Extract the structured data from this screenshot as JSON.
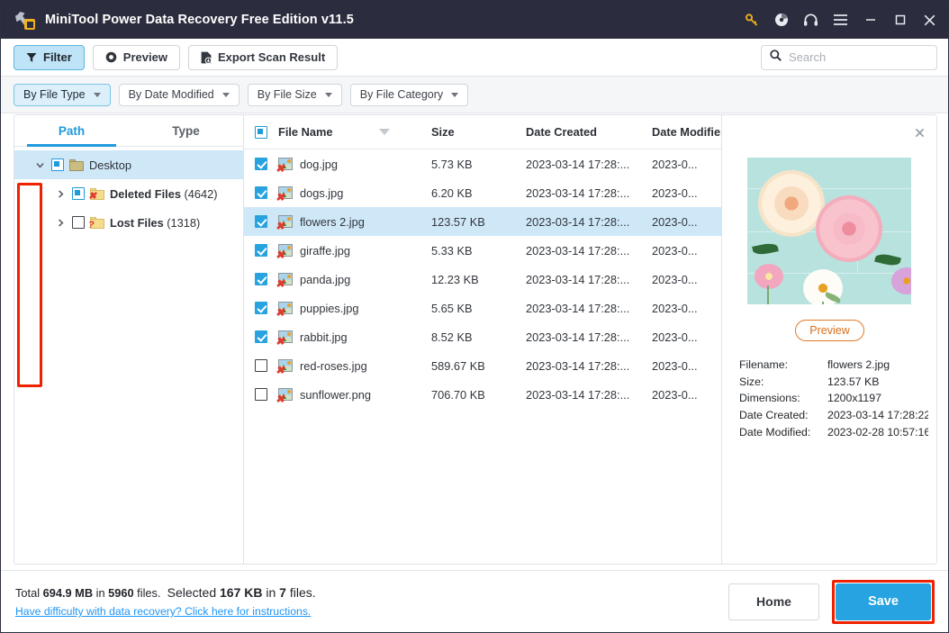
{
  "window": {
    "title": "MiniTool Power Data Recovery Free Edition v11.5",
    "icons": {
      "key": "key-icon",
      "disc": "disc-icon",
      "headphones": "headphones-icon",
      "menu": "hamburger-menu-icon",
      "minimize": "minimize-icon",
      "maximize": "maximize-icon",
      "close": "close-icon"
    }
  },
  "toolbar": {
    "filter_label": "Filter",
    "preview_label": "Preview",
    "export_label": "Export Scan Result"
  },
  "search": {
    "placeholder": "Search",
    "value": ""
  },
  "filters": [
    {
      "label": "By File Type",
      "active": true
    },
    {
      "label": "By Date Modified",
      "active": false
    },
    {
      "label": "By File Size",
      "active": false
    },
    {
      "label": "By File Category",
      "active": false
    }
  ],
  "tree": {
    "tabs": [
      {
        "label": "Path",
        "active": true
      },
      {
        "label": "Type",
        "active": false
      }
    ],
    "items": [
      {
        "label": "Desktop",
        "count": "",
        "state": "partial",
        "selected": true,
        "expanded": true,
        "depth": 0,
        "folder": "plain"
      },
      {
        "label": "Deleted Files",
        "count": "(4642)",
        "state": "partial",
        "selected": false,
        "expanded": false,
        "depth": 1,
        "folder": "deleted"
      },
      {
        "label": "Lost Files",
        "count": "(1318)",
        "state": "unchecked",
        "selected": false,
        "expanded": false,
        "depth": 1,
        "folder": "lost"
      }
    ]
  },
  "filelist": {
    "columns": {
      "name": "File Name",
      "size": "Size",
      "date_created": "Date Created",
      "date_modified": "Date Modifie"
    },
    "header_checkbox_state": "partial",
    "rows": [
      {
        "name": "dog.jpg",
        "size": "5.73 KB",
        "date_created": "2023-03-14 17:28:...",
        "date_modified": "2023-0...",
        "checked": true,
        "selected": false
      },
      {
        "name": "dogs.jpg",
        "size": "6.20 KB",
        "date_created": "2023-03-14 17:28:...",
        "date_modified": "2023-0...",
        "checked": true,
        "selected": false
      },
      {
        "name": "flowers 2.jpg",
        "size": "123.57 KB",
        "date_created": "2023-03-14 17:28:...",
        "date_modified": "2023-0...",
        "checked": true,
        "selected": true
      },
      {
        "name": "giraffe.jpg",
        "size": "5.33 KB",
        "date_created": "2023-03-14 17:28:...",
        "date_modified": "2023-0...",
        "checked": true,
        "selected": false
      },
      {
        "name": "panda.jpg",
        "size": "12.23 KB",
        "date_created": "2023-03-14 17:28:...",
        "date_modified": "2023-0...",
        "checked": true,
        "selected": false
      },
      {
        "name": "puppies.jpg",
        "size": "5.65 KB",
        "date_created": "2023-03-14 17:28:...",
        "date_modified": "2023-0...",
        "checked": true,
        "selected": false
      },
      {
        "name": "rabbit.jpg",
        "size": "8.52 KB",
        "date_created": "2023-03-14 17:28:...",
        "date_modified": "2023-0...",
        "checked": true,
        "selected": false
      },
      {
        "name": "red-roses.jpg",
        "size": "589.67 KB",
        "date_created": "2023-03-14 17:28:...",
        "date_modified": "2023-0...",
        "checked": false,
        "selected": false
      },
      {
        "name": "sunflower.png",
        "size": "706.70 KB",
        "date_created": "2023-03-14 17:28:...",
        "date_modified": "2023-0...",
        "checked": false,
        "selected": false
      }
    ]
  },
  "preview": {
    "button_label": "Preview",
    "close_icon": "close-icon",
    "meta": [
      {
        "key": "Filename:",
        "value": "flowers 2.jpg"
      },
      {
        "key": "Size:",
        "value": "123.57 KB"
      },
      {
        "key": "Dimensions:",
        "value": "1200x1197"
      },
      {
        "key": "Date Created:",
        "value": "2023-03-14 17:28:22"
      },
      {
        "key": "Date Modified:",
        "value": "2023-02-28 10:57:16"
      }
    ]
  },
  "footer": {
    "total_prefix": "Total ",
    "total_size": "694.9 MB",
    "total_mid": " in ",
    "total_files": "5960",
    "total_suffix": " files.",
    "selected_prefix": "Selected ",
    "selected_size": "167 KB",
    "selected_mid": " in ",
    "selected_files": "7",
    "selected_suffix": " files.",
    "help_link": "Have difficulty with data recovery? Click here for instructions.",
    "home_label": "Home",
    "save_label": "Save"
  },
  "colors": {
    "titlebar": "#2b2d3e",
    "accent": "#26a3e0",
    "annotation": "#ee2200",
    "selection": "#cfe8f8",
    "preview_orange": "#e07a26"
  }
}
